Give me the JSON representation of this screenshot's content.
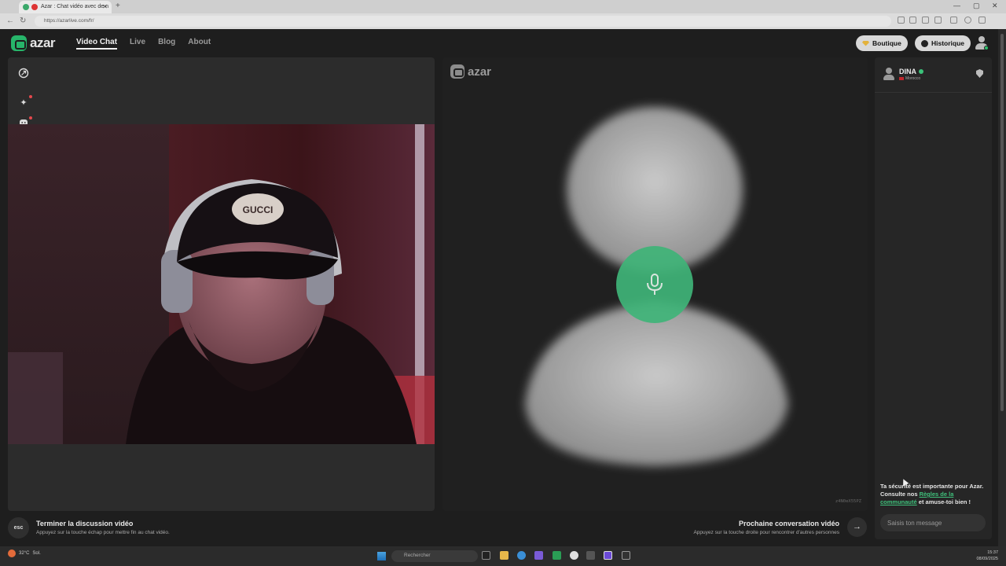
{
  "browser": {
    "tab_title": "Azar : Chat vidéo avec de n",
    "url": "https://azarlive.com/fr/"
  },
  "header": {
    "logo_text": "azar",
    "nav": [
      "Video Chat",
      "Live",
      "Blog",
      "About"
    ],
    "shop_label": "Boutique",
    "history_label": "Historique"
  },
  "peer": {
    "logo_text": "azar",
    "session_id": "z4N0eX55PZ"
  },
  "chat": {
    "partner_name": "DINA",
    "partner_country": "Morocco",
    "safety_text_1": "Ta sécurité est importante pour Azar. Consulte nos ",
    "safety_link": "Règles de la communauté",
    "safety_text_2": " et amuse-toi bien !",
    "input_placeholder": "Saisis ton message"
  },
  "footer": {
    "esc_key": "esc",
    "end_title": "Terminer la discussion vidéo",
    "end_sub": "Appuyez sur la touche échap pour mettre fin au chat vidéo.",
    "next_title": "Prochaine conversation vidéo",
    "next_sub": "Appuyez sur la touche droite pour rencontrer d'autres personnes"
  },
  "taskbar": {
    "weather_temp": "32°C",
    "weather_desc": "Sol.",
    "search_placeholder": "Rechercher",
    "time": "15:37",
    "date": "08/09/2025"
  },
  "colors": {
    "brand": "#27b56a",
    "mic": "#3fb478",
    "online": "#3bc27a"
  }
}
